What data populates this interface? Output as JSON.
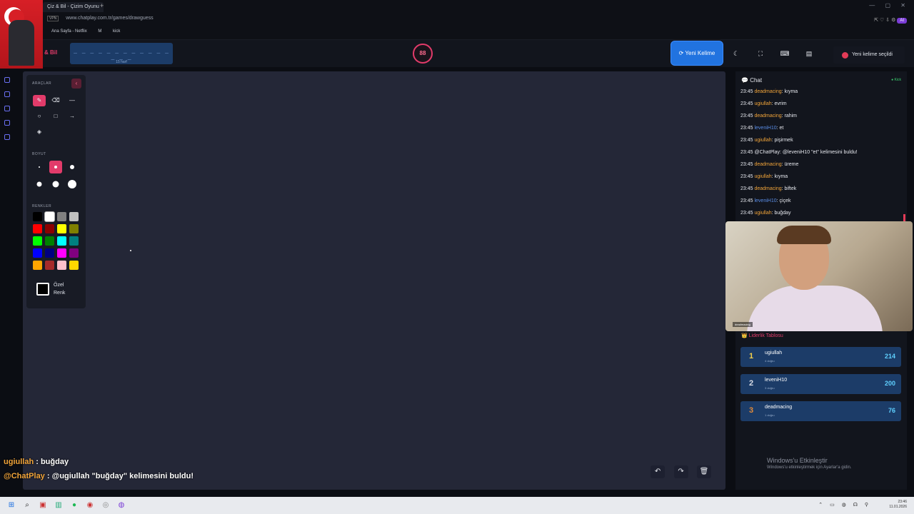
{
  "browser": {
    "tab_title": "Çiz & Bil - Çizim Oyunu",
    "new_tab": "+",
    "url_badge": "VPN",
    "url": "www.chatplay.com.tr/games/drawguess",
    "bookmarks": [
      "Ana Sayfa - Netflix",
      "M",
      "kick"
    ],
    "ai_label": "AI",
    "window_controls": "— ▢ ✕"
  },
  "header": {
    "brand": "& Bil",
    "word_dashes": "_ _ _ _ _ _ _ _ _ _ _ _ _ _ _",
    "word_hint": "15 harf",
    "timer": "88",
    "new_word_button": "⟳ Yeni Kelime",
    "toast": "Yeni kelime seçildi"
  },
  "toolbox": {
    "tools_title": "ARAÇLAR",
    "size_title": "BOYUT",
    "colors_title": "RENKLER",
    "custom_color_label": "Özel Renk",
    "colors": [
      "#000000",
      "#ffffff",
      "#808080",
      "#c0c0c0",
      "#ff0000",
      "#8b0000",
      "#ffff00",
      "#808000",
      "#00ff00",
      "#008000",
      "#00ffff",
      "#008080",
      "#0000ff",
      "#000080",
      "#ff00ff",
      "#800080",
      "#ffa500",
      "#a52a2a",
      "#ffc0cb",
      "#ffd700"
    ]
  },
  "chat": {
    "title": "Chat",
    "source": "Kick",
    "messages": [
      {
        "time": "23:45",
        "user": "deadmacing",
        "text": ": kıyma",
        "color": "orange"
      },
      {
        "time": "23:45",
        "user": "ugiullah",
        "text": ": evrim",
        "color": "orange"
      },
      {
        "time": "23:45",
        "user": "deadmacing",
        "text": ": rahim",
        "color": "orange"
      },
      {
        "time": "23:45",
        "user": "leveniH10",
        "text": ": et",
        "color": "blue"
      },
      {
        "time": "23:45",
        "user": "ugiullah",
        "text": ": pişirmek",
        "color": "orange"
      },
      {
        "time": "23:45",
        "user": "",
        "text": "@ChatPlay: @leveniH10 \"et\" kelimesini buldu!",
        "color": "none"
      },
      {
        "time": "23:45",
        "user": "deadmacing",
        "text": ": üreme",
        "color": "orange"
      },
      {
        "time": "23:45",
        "user": "ugiullah",
        "text": ": kıyma",
        "color": "orange"
      },
      {
        "time": "23:45",
        "user": "deadmacing",
        "text": ": biftek",
        "color": "orange"
      },
      {
        "time": "23:45",
        "user": "leveniH10",
        "text": ": çiçek",
        "color": "blue"
      },
      {
        "time": "23:45",
        "user": "ugiullah",
        "text": ": buğday",
        "color": "orange"
      }
    ]
  },
  "webcam": {
    "name": "deadmacing"
  },
  "leaderboard": {
    "title": "👑 Liderlik Tablosu",
    "rows": [
      {
        "rank": "1",
        "name": "ugiullah",
        "sub": "4 doğru",
        "score": "214",
        "rank_color": "#f5d04a"
      },
      {
        "rank": "2",
        "name": "leveniH10",
        "sub": "3 doğru",
        "score": "200",
        "rank_color": "#d9dde6"
      },
      {
        "rank": "3",
        "name": "deadmacing",
        "sub": "1 doğru",
        "score": "76",
        "rank_color": "#e08a3a"
      }
    ]
  },
  "windows_notice": {
    "line1": "Windows'u Etkinleştir",
    "line2": "Windows'u etkinleştirmek için Ayarlar'a gidin."
  },
  "overlay": {
    "line1_user": "ugiullah",
    "line1_text": " : buğday",
    "line2_user": "@ChatPlay",
    "line2_text": " : @ugiullah \"buğday\" kelimesini buldu!"
  },
  "taskbar": {
    "time": "23:46",
    "date": "11.01.2026"
  }
}
